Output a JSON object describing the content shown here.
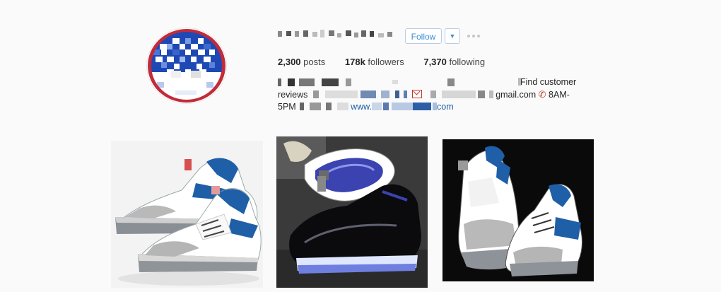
{
  "profile": {
    "follow_label": "Follow",
    "dropdown_glyph": "▼",
    "stats": {
      "posts_count": "2,300",
      "posts_label": "posts",
      "followers_count": "178k",
      "followers_label": "followers",
      "following_count": "7,370",
      "following_label": "following"
    },
    "bio": {
      "line1_text": "Find customer",
      "line2_prefix": "reviews",
      "line2_email_suffix": "gmail.com",
      "line2_hours": "8AM-",
      "line3_hours": "5PM",
      "line3_www": "www.",
      "line3_tld": "com"
    }
  },
  "posts": [
    {
      "alt": "white and blue sneakers with elephant print, white background"
    },
    {
      "alt": "black patent sneakers with blue translucent sole"
    },
    {
      "alt": "white and blue sneakers with elephant print, black background"
    }
  ],
  "colors": {
    "link": "#1c5fa3",
    "follow_blue": "#3b8ed4",
    "sneaker_blue": "#1f5fa8",
    "background": "#fafafa"
  },
  "icons": [
    "more-icon",
    "mail-icon",
    "phone-icon",
    "dropdown-arrow-icon"
  ]
}
